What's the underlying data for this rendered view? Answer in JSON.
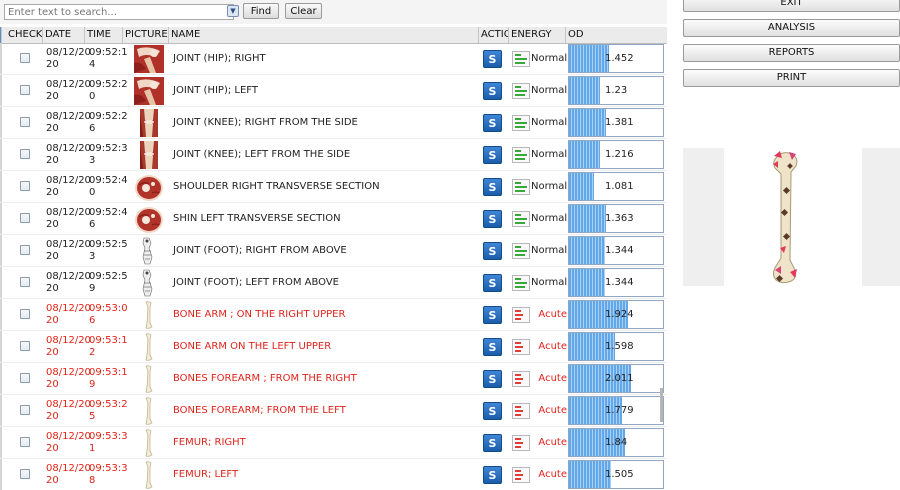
{
  "search": {
    "placeholder": "Enter text to search...",
    "dropdown_icon": "chevron-down-icon",
    "find_label": "Find",
    "clear_label": "Clear"
  },
  "columns": [
    "CHECKE",
    "DATE",
    "TIME",
    "PICTURE",
    "NAME",
    "ACTION",
    "ENERGY",
    "OD"
  ],
  "rows": [
    {
      "date": "08/12/20\n20",
      "time": "09:52:1\n4",
      "picture": "hip-anatomy",
      "name": "JOINT (HIP);  RIGHT",
      "energy": "Normal",
      "od": "1.452",
      "acute": false
    },
    {
      "date": "08/12/20\n20",
      "time": "09:52:2\n0",
      "picture": "hip-anatomy",
      "name": "JOINT (HIP);  LEFT",
      "energy": "Normal",
      "od": "1.23",
      "acute": false
    },
    {
      "date": "08/12/20\n20",
      "time": "09:52:2\n6",
      "picture": "knee-anatomy",
      "name": "JOINT (KNEE); RIGHT FROM THE SIDE",
      "energy": "Normal",
      "od": "1.381",
      "acute": false
    },
    {
      "date": "08/12/20\n20",
      "time": "09:52:3\n3",
      "picture": "knee-anatomy",
      "name": "JOINT (KNEE);  LEFT FROM THE SIDE",
      "energy": "Normal",
      "od": "1.216",
      "acute": false
    },
    {
      "date": "08/12/20\n20",
      "time": "09:52:4\n0",
      "picture": "cross-section",
      "name": "SHOULDER RIGHT TRANSVERSE SECTION",
      "energy": "Normal",
      "od": "1.081",
      "acute": false
    },
    {
      "date": "08/12/20\n20",
      "time": "09:52:4\n6",
      "picture": "cross-section",
      "name": "SHIN LEFT TRANSVERSE SECTION",
      "energy": "Normal",
      "od": "1.363",
      "acute": false
    },
    {
      "date": "08/12/20\n20",
      "time": "09:52:5\n3",
      "picture": "foot-bones",
      "name": "JOINT (FOOT); RIGHT FROM ABOVE",
      "energy": "Normal",
      "od": "1.344",
      "acute": false
    },
    {
      "date": "08/12/20\n20",
      "time": "09:52:5\n9",
      "picture": "foot-bones",
      "name": "JOINT (FOOT); LEFT FROM ABOVE",
      "energy": "Normal",
      "od": "1.344",
      "acute": false
    },
    {
      "date": "08/12/20\n20",
      "time": "09:53:0\n6",
      "picture": "bone",
      "name": "BONE ARM ; ON THE RIGHT UPPER",
      "energy": "Acute",
      "od": "1.924",
      "acute": true
    },
    {
      "date": "08/12/20\n20",
      "time": "09:53:1\n2",
      "picture": "bone",
      "name": "BONE ARM ON THE LEFT UPPER",
      "energy": "Acute",
      "od": "1.598",
      "acute": true
    },
    {
      "date": "08/12/20\n20",
      "time": "09:53:1\n9",
      "picture": "bone",
      "name": "BONES FOREARM ; FROM THE RIGHT",
      "energy": "Acute",
      "od": "2.011",
      "acute": true
    },
    {
      "date": "08/12/20\n20",
      "time": "09:53:2\n5",
      "picture": "bone",
      "name": "BONES FOREARM; FROM THE LEFT",
      "energy": "Acute",
      "od": "1.779",
      "acute": true
    },
    {
      "date": "08/12/20\n20",
      "time": "09:53:3\n1",
      "picture": "bone",
      "name": "FEMUR; RIGHT",
      "energy": "Acute",
      "od": "1.84",
      "acute": true
    },
    {
      "date": "08/12/20\n20",
      "time": "09:53:3\n8",
      "picture": "bone",
      "name": "FEMUR; LEFT",
      "energy": "Acute",
      "od": "1.505",
      "acute": true
    }
  ],
  "action_label": "S",
  "right_panel": {
    "buttons": [
      "EXIT",
      "ANALYSIS",
      "REPORTS",
      "PRINT"
    ],
    "preview": "femur-bone"
  },
  "colors": {
    "acute": "#e0241b",
    "od_fill": "#62a7e8",
    "action": "#1f63b3"
  }
}
